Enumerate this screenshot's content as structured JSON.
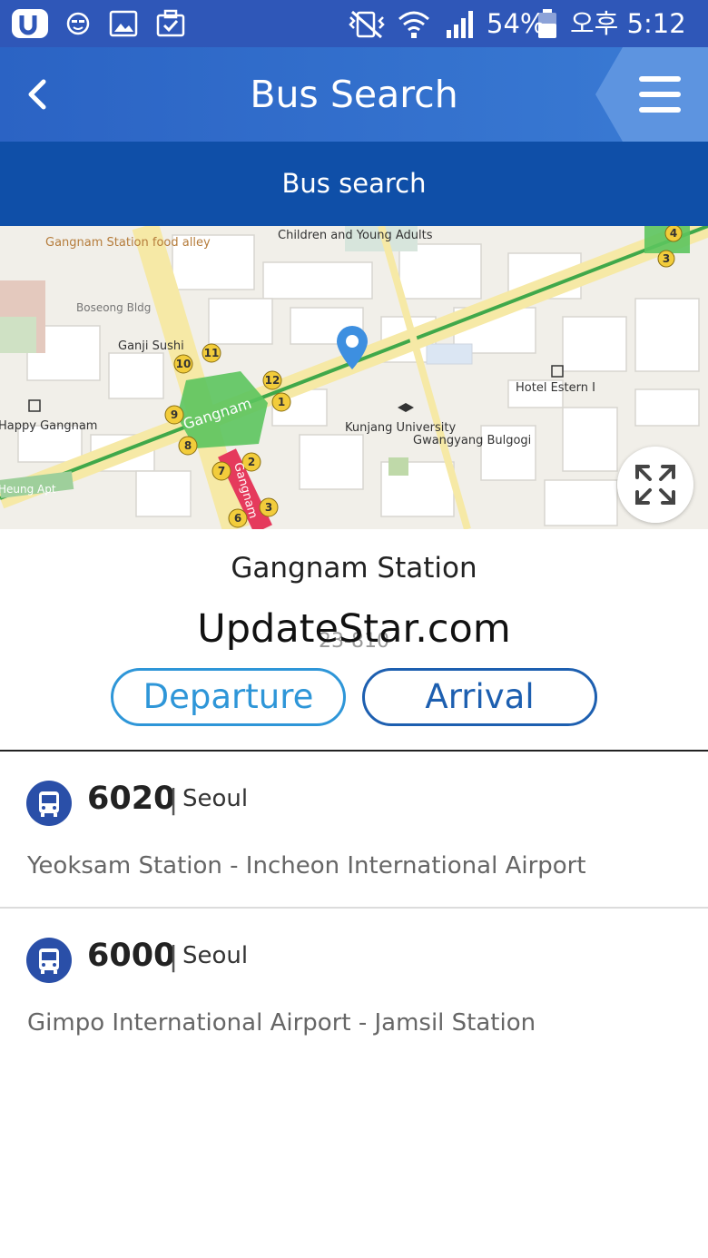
{
  "status_bar": {
    "battery": "54%",
    "time": "오후 5:12"
  },
  "header": {
    "title": "Bus Search",
    "subtitle": "Bus search"
  },
  "map": {
    "labels": {
      "food_alley": "Gangnam Station food alley",
      "children": "Children and Young Adults",
      "boseong": "Boseong Bldg",
      "ganji": "Ganji Sushi",
      "gangnam_station": "Gangnam",
      "happy": "Happy Gangnam",
      "heung": "Heung Apt",
      "hotel": "Hotel Estern I",
      "kunjang": "Kunjang University",
      "gwangyang": "Gwangyang Bulgogi",
      "vertical_road": "Gangnam"
    },
    "exits": [
      "1",
      "2",
      "3",
      "6",
      "7",
      "8",
      "9",
      "10",
      "11",
      "12",
      "3",
      "4"
    ]
  },
  "station": {
    "name": "Gangnam Station",
    "watermark": "UpdateStar.com",
    "code": "23-810"
  },
  "actions": {
    "departure": "Departure",
    "arrival": "Arrival"
  },
  "routes": [
    {
      "number": "6020",
      "region": "Seoul",
      "path": "Yeoksam Station - Incheon International Airport"
    },
    {
      "number": "6000",
      "region": "Seoul",
      "path": "Gimpo International Airport - Jamsil Station"
    }
  ],
  "colors": {
    "status_bar": "#2f57b8",
    "header": "#3a7bd4",
    "subheader": "#0f4fa8",
    "departure": "#2e96d8",
    "arrival": "#1d5fb0",
    "bus_icon": "#2a4fa8"
  }
}
